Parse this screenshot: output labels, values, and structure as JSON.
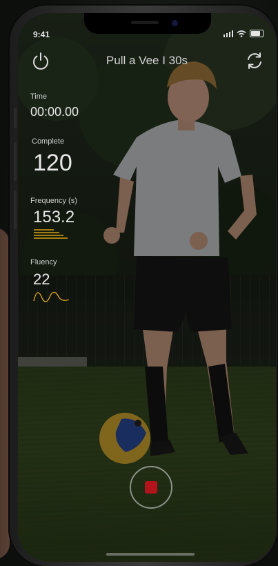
{
  "status_bar": {
    "time": "9:41"
  },
  "header": {
    "title": "Pull a Vee I 30s",
    "power_icon": "power-icon",
    "refresh_icon": "refresh-icon"
  },
  "stats": {
    "time": {
      "label": "Time",
      "value": "00:00.00"
    },
    "complete": {
      "label": "Complete",
      "value": "120"
    },
    "frequency": {
      "label": "Frequency (s)",
      "value": "153.2"
    },
    "fluency": {
      "label": "Fluency",
      "value": "22"
    }
  },
  "controls": {
    "record_icon": "stop-icon",
    "record_color": "#b3131a"
  },
  "colors": {
    "accent": "#d4a017",
    "text": "#e8e8e8"
  }
}
